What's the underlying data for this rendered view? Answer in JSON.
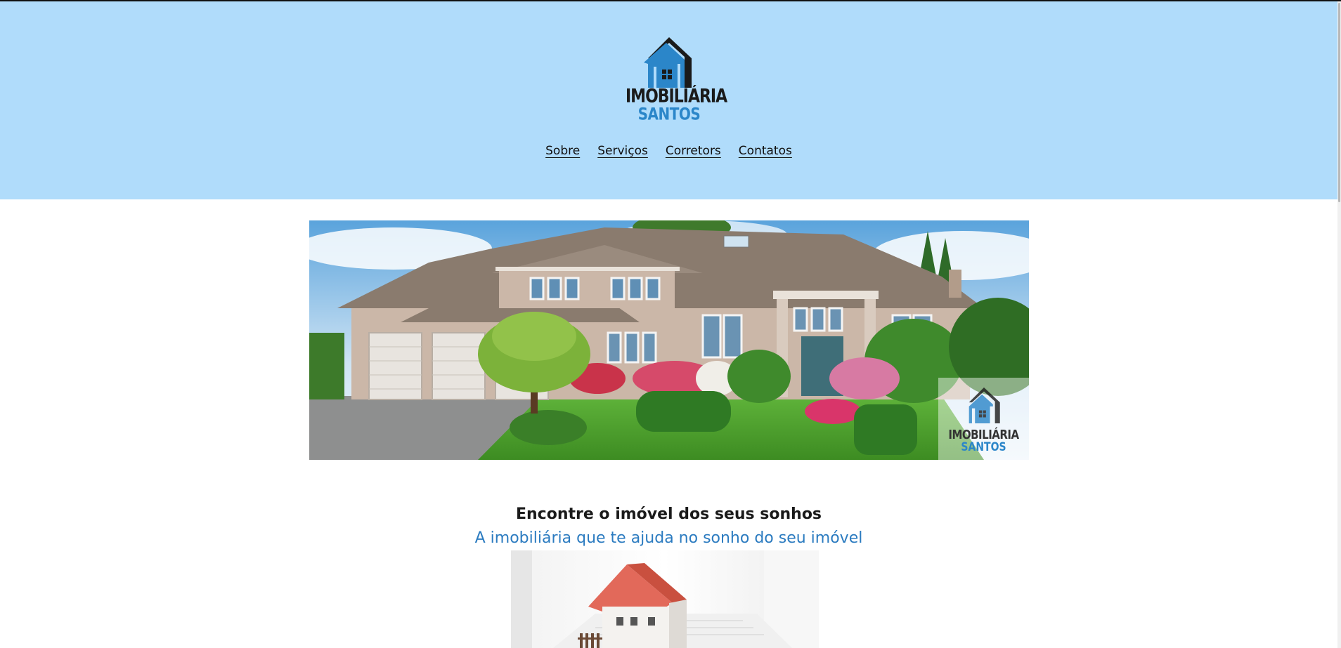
{
  "brand": {
    "name_line1": "IMOBILIÁRIA",
    "name_line2": "SANTOS",
    "icon": "house-logo-icon",
    "colors": {
      "header_bg": "#b0dcfb",
      "brand_blue": "#2b86c9",
      "brand_dark": "#1a1a1a"
    }
  },
  "nav": {
    "items": [
      {
        "label": "Sobre"
      },
      {
        "label": "Serviços"
      },
      {
        "label": "Corretors"
      },
      {
        "label": "Contatos"
      }
    ]
  },
  "hero": {
    "watermark_line1": "IMOBILIÁRIA",
    "watermark_line2": "SANTOS"
  },
  "intro": {
    "headline": "Encontre o imóvel dos seus sonhos",
    "subline": "A imobiliária que te ajuda no sonho do seu imóvel"
  }
}
